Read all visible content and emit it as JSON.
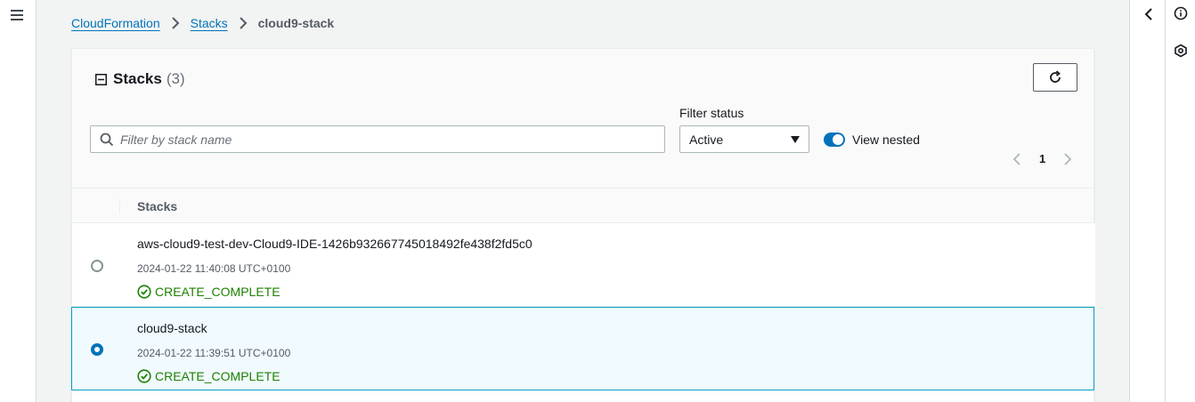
{
  "breadcrumb": {
    "items": [
      {
        "label": "CloudFormation"
      },
      {
        "label": "Stacks"
      }
    ],
    "current": "cloud9-stack"
  },
  "panel": {
    "title": "Stacks",
    "count": "(3)"
  },
  "search": {
    "placeholder": "Filter by stack name",
    "value": ""
  },
  "filter": {
    "label": "Filter status",
    "selected": "Active"
  },
  "toggle": {
    "label": "View nested",
    "on": true
  },
  "pagination": {
    "current_page": "1"
  },
  "table": {
    "column_header": "Stacks",
    "rows": [
      {
        "name": "aws-cloud9-test-dev-Cloud9-IDE-1426b932667745018492fe438f2fd5c0",
        "created": "2024-01-22 11:40:08 UTC+0100",
        "status": "CREATE_COMPLETE",
        "selected": false
      },
      {
        "name": "cloud9-stack",
        "created": "2024-01-22 11:39:51 UTC+0100",
        "status": "CREATE_COMPLETE",
        "selected": true
      }
    ]
  },
  "icons": {
    "menu": "hamburger-menu-icon",
    "collapse_panel": "chevron-left-icon",
    "info": "info-icon",
    "security": "shield-hexagon-icon",
    "refresh": "refresh-icon",
    "search": "search-icon",
    "status_ok": "check-circle-icon"
  },
  "colors": {
    "link": "#0073bb",
    "success": "#1d8102",
    "selected_border": "#00a1c9",
    "selected_bg": "#f1faff",
    "toggle_on": "#0073bb"
  }
}
